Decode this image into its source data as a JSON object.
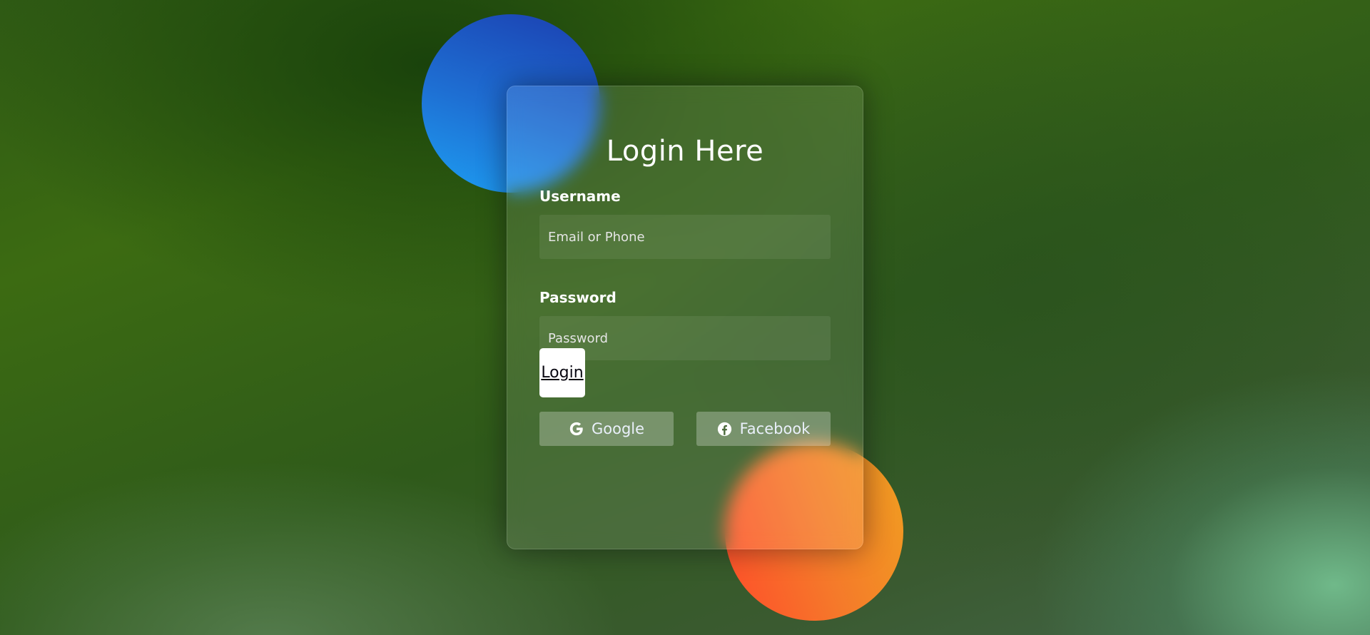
{
  "form": {
    "title": "Login Here",
    "username": {
      "label": "Username",
      "placeholder": "Email or Phone"
    },
    "password": {
      "label": "Password",
      "placeholder": "Password"
    },
    "login_label": "Login"
  },
  "social": [
    {
      "label": "Google",
      "icon": "google-icon"
    },
    {
      "label": "Facebook",
      "icon": "facebook-icon"
    }
  ],
  "colors": {
    "background": "#3c6b12",
    "blue_circle": "#1e6fd3",
    "orange_circle": "#f57a2a",
    "text": "#ffffff"
  }
}
